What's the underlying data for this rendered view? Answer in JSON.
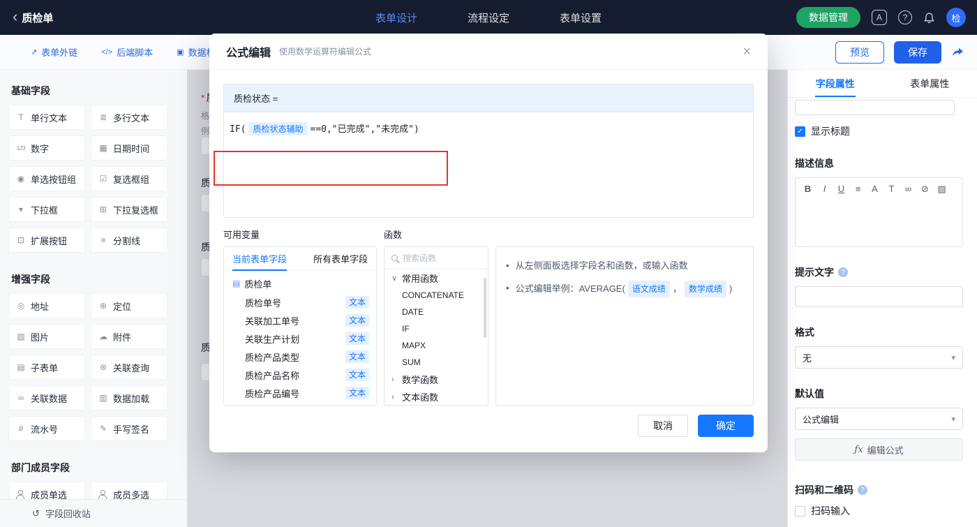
{
  "colors": {
    "primary": "#1677ff",
    "topbar_bg": "#161d30",
    "data_manage_green": "#1fa364",
    "tag_bg": "#e4f0fe",
    "annotation_red": "#e5342c"
  },
  "glyphs": {
    "back": "‹",
    "close": "×",
    "check": "✓",
    "chevron_down": "∨",
    "chevron_right": "›",
    "caret": "▾",
    "bullet": "•",
    "doc": "▤",
    "share": "↗",
    "recycle": "↺",
    "fx": "ƒx"
  },
  "topbar": {
    "title": "质检单",
    "nav": [
      {
        "label": "表单设计",
        "active": true
      },
      {
        "label": "流程设定",
        "active": false
      },
      {
        "label": "表单设置",
        "active": false
      }
    ],
    "data_manage_label": "数据管理",
    "translate_glyph": "A",
    "help_glyph": "?",
    "avatar_text": "检"
  },
  "subbar": {
    "items": [
      {
        "label": "表单外链",
        "icon": "external-link-icon",
        "glyph": "↗"
      },
      {
        "label": "后端脚本",
        "icon": "script-icon",
        "glyph": "</>"
      },
      {
        "label": "数据权",
        "icon": "data-permission-icon",
        "glyph": "▣"
      }
    ],
    "preview_label": "预览",
    "save_label": "保存"
  },
  "sidebar": {
    "sections": [
      {
        "title": "基础字段",
        "items": [
          {
            "label": "单行文本",
            "icon": "single-line-text-icon",
            "glyph": "T"
          },
          {
            "label": "多行文本",
            "icon": "multi-line-text-icon",
            "glyph": "≣"
          },
          {
            "label": "数字",
            "icon": "number-icon",
            "glyph": "123"
          },
          {
            "label": "日期时间",
            "icon": "datetime-icon",
            "glyph": "▦"
          },
          {
            "label": "单选按钮组",
            "icon": "radio-group-icon",
            "glyph": "◉"
          },
          {
            "label": "复选框组",
            "icon": "checkbox-group-icon",
            "glyph": "☑"
          },
          {
            "label": "下拉框",
            "icon": "dropdown-icon",
            "glyph": "▾"
          },
          {
            "label": "下拉复选框",
            "icon": "multi-dropdown-icon",
            "glyph": "⊞"
          },
          {
            "label": "扩展按钮",
            "icon": "extend-button-icon",
            "glyph": "⊡"
          },
          {
            "label": "分割线",
            "icon": "divider-icon",
            "glyph": "≡"
          }
        ]
      },
      {
        "title": "增强字段",
        "items": [
          {
            "label": "地址",
            "icon": "address-icon",
            "glyph": "◎"
          },
          {
            "label": "定位",
            "icon": "location-icon",
            "glyph": "⊕"
          },
          {
            "label": "图片",
            "icon": "image-icon",
            "glyph": "▧"
          },
          {
            "label": "附件",
            "icon": "attachment-icon",
            "glyph": "☁"
          },
          {
            "label": "子表单",
            "icon": "subform-icon",
            "glyph": "▤"
          },
          {
            "label": "关联查询",
            "icon": "linked-query-icon",
            "glyph": "⊛"
          },
          {
            "label": "关联数据",
            "icon": "linked-data-icon",
            "glyph": "∞"
          },
          {
            "label": "数据加载",
            "icon": "data-load-icon",
            "glyph": "▥"
          },
          {
            "label": "流水号",
            "icon": "serial-number-icon",
            "glyph": "#"
          },
          {
            "label": "手写签名",
            "icon": "signature-icon",
            "glyph": "✎"
          }
        ]
      },
      {
        "title": "部门成员字段",
        "items": [
          {
            "label": "成员单选",
            "icon": "user-icon",
            "glyph": ""
          },
          {
            "label": "成员多选",
            "icon": "users-icon",
            "glyph": ""
          }
        ]
      }
    ],
    "recycle_label": "字段回收站"
  },
  "canvas": {
    "req_mark": "*",
    "req_label": "质",
    "hint1": "格",
    "hint2": "例",
    "label2": "质",
    "label3": "质",
    "label4": "质"
  },
  "modal": {
    "title": "公式编辑",
    "subtitle": "使用数学运算符编辑公式",
    "target_label": "质检状态 =",
    "formula": {
      "fn": "IF(",
      "field_tag": "质检状态辅助",
      "rest": "==0,\"已完成\",\"未完成\")"
    },
    "variables_label": "可用变量",
    "functions_label": "函数",
    "variable_tabs": [
      {
        "label": "当前表单字段",
        "active": true
      },
      {
        "label": "所有表单字段",
        "active": false
      }
    ],
    "form_name": "质检单",
    "fields": [
      {
        "name": "质检单号",
        "type": "文本"
      },
      {
        "name": "关联加工单号",
        "type": "文本"
      },
      {
        "name": "关联生产计划",
        "type": "文本"
      },
      {
        "name": "质检产品类型",
        "type": "文本"
      },
      {
        "name": "质检产品名称",
        "type": "文本"
      },
      {
        "name": "质检产品编号",
        "type": "文本"
      }
    ],
    "search_placeholder": "搜索函数",
    "function_groups": [
      {
        "name": "常用函数",
        "expanded": true,
        "items": [
          "CONCATENATE",
          "DATE",
          "IF",
          "MAPX",
          "SUM"
        ]
      },
      {
        "name": "数学函数",
        "expanded": false,
        "items": []
      },
      {
        "name": "文本函数",
        "expanded": false,
        "items": []
      }
    ],
    "tip1": "从左侧面板选择字段名和函数，或输入函数",
    "tip2": {
      "prefix": "公式编辑举例：AVERAGE(",
      "tag1": "语文成绩",
      "separator": "，",
      "tag2": "数学成绩",
      "suffix": ")"
    },
    "cancel_label": "取消",
    "confirm_label": "确定"
  },
  "right_panel": {
    "tabs": [
      {
        "label": "字段属性",
        "active": true
      },
      {
        "label": "表单属性",
        "active": false
      }
    ],
    "show_title": {
      "label": "显示标题",
      "checked": true
    },
    "description_label": "描述信息",
    "editor_icons": [
      "B",
      "I",
      "U",
      "≡",
      "A",
      "T",
      "∞",
      "⊘",
      "▨"
    ],
    "hint_label": "提示文字",
    "hint_value": "",
    "format_label": "格式",
    "format_value": "无",
    "default_label": "默认值",
    "default_value": "公式编辑",
    "formula_button_label": "编辑公式",
    "scan_label": "扫码和二维码",
    "scan_checkbox": {
      "label": "扫码输入",
      "checked": false
    },
    "help_glyph": "?"
  }
}
